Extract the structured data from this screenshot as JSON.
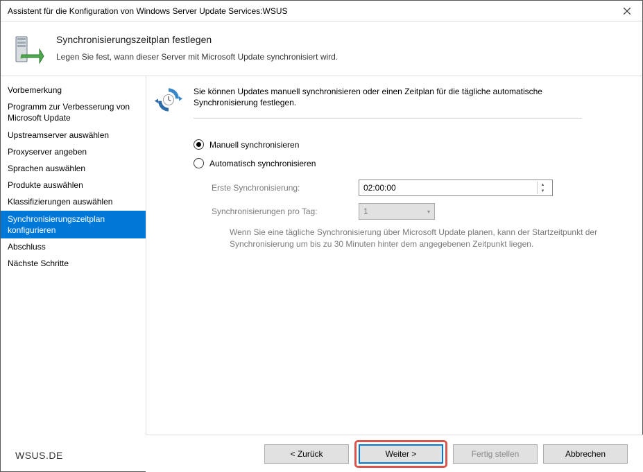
{
  "window": {
    "title": "Assistent für die Konfiguration von Windows Server Update Services:WSUS"
  },
  "header": {
    "heading": "Synchronisierungszeitplan festlegen",
    "sub": "Legen Sie fest, wann dieser Server mit Microsoft Update synchronisiert wird."
  },
  "sidebar": {
    "items": [
      "Vorbemerkung",
      "Programm zur Verbesserung von Microsoft Update",
      "Upstreamserver auswählen",
      "Proxyserver angeben",
      "Sprachen auswählen",
      "Produkte auswählen",
      "Klassifizierungen auswählen",
      "Synchronisierungszeitplan konfigurieren",
      "Abschluss",
      "Nächste Schritte"
    ],
    "selectedIndex": 7
  },
  "main": {
    "intro": "Sie können Updates manuell synchronisieren oder einen Zeitplan für die tägliche automatische Synchronisierung festlegen.",
    "option_manual": "Manuell synchronisieren",
    "option_auto": "Automatisch synchronisieren",
    "selected_option": "manual",
    "first_sync_label": "Erste Synchronisierung:",
    "first_sync_value": "02:00:00",
    "per_day_label": "Synchronisierungen pro Tag:",
    "per_day_value": "1",
    "note": "Wenn Sie eine tägliche Synchronisierung über Microsoft Update planen, kann der Startzeitpunkt der Synchronisierung um bis zu 30 Minuten hinter dem angegebenen Zeitpunkt liegen."
  },
  "footer": {
    "brand": "WSUS.DE",
    "back": "< Zurück",
    "next": "Weiter >",
    "finish": "Fertig stellen",
    "cancel": "Abbrechen"
  }
}
